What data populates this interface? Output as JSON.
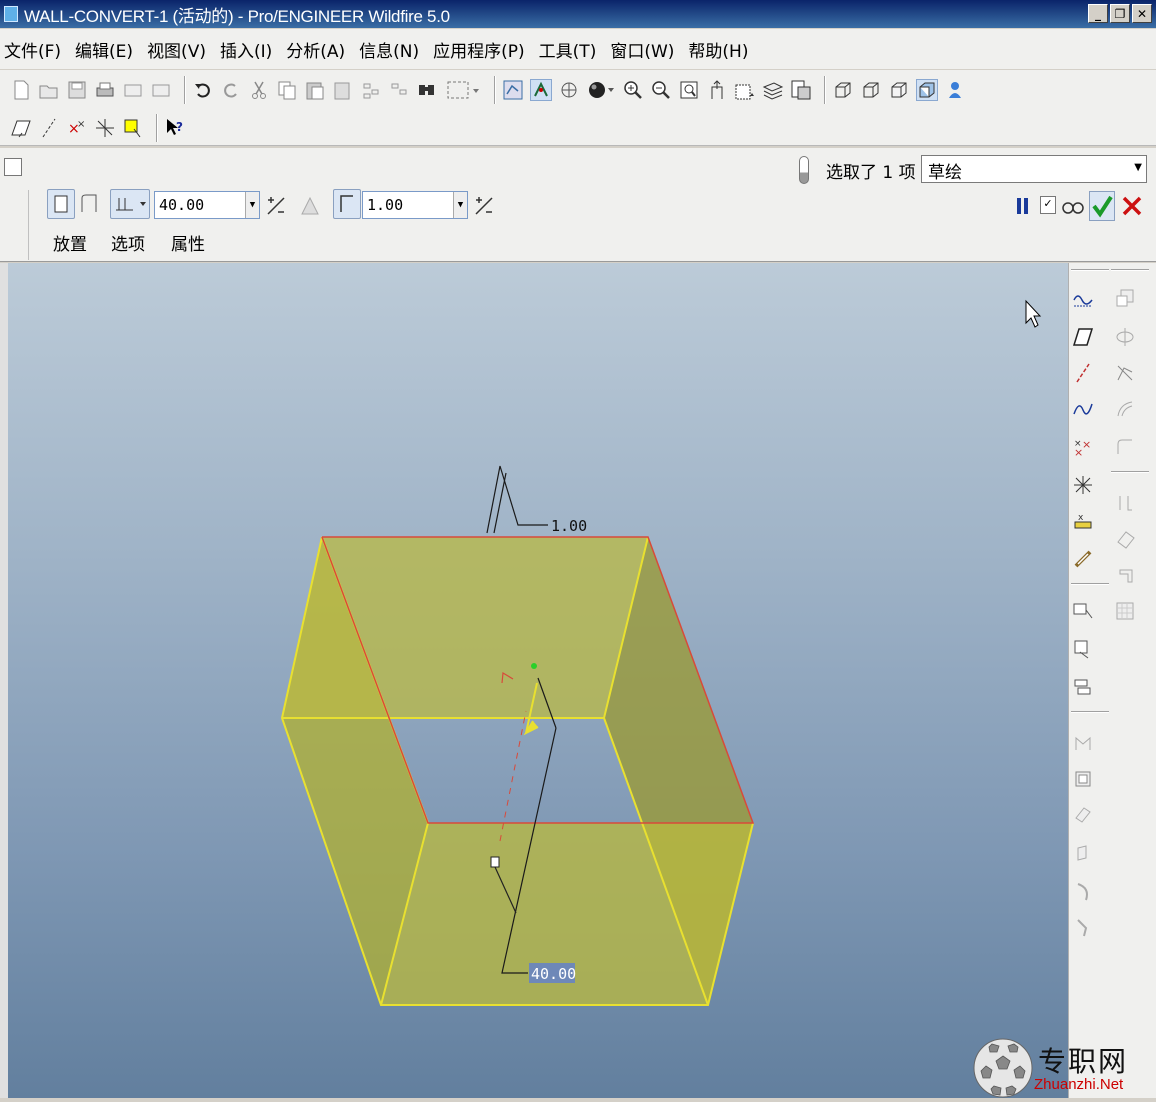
{
  "window": {
    "title": "WALL-CONVERT-1 (活动的) - Pro/ENGINEER Wildfire 5.0"
  },
  "menu": [
    "文件(F)",
    "编辑(E)",
    "视图(V)",
    "插入(I)",
    "分析(A)",
    "信息(N)",
    "应用程序(P)",
    "工具(T)",
    "窗口(W)",
    "帮助(H)"
  ],
  "selection": {
    "status": "选取了 1 项",
    "filter": "草绘"
  },
  "dashboard": {
    "height_value": "40.00",
    "thickness_value": "1.00",
    "tabs": [
      "放置",
      "选项",
      "属性"
    ]
  },
  "viewport": {
    "dim_thickness": "1.00",
    "dim_height": "40.00"
  },
  "watermark": {
    "cn": "专职网",
    "en": "Zhuanzhi.Net"
  },
  "colors": {
    "title_bar": "#0a246a",
    "part_fill": "#b5b83a",
    "edge_highlight": "#e8e030",
    "edge_red": "#d84a3a",
    "accept_check": "#1a9a2a",
    "cancel_x": "#cc1111"
  },
  "icons": [
    "new-file-icon",
    "open-icon",
    "save-icon",
    "print-icon",
    "undo-icon",
    "redo-icon",
    "cut-icon",
    "copy-icon",
    "paste-icon",
    "regenerate-icon",
    "zoom-in-icon",
    "zoom-out-icon",
    "refit-icon",
    "pause-icon",
    "preview-icon",
    "accept-icon",
    "cancel-icon"
  ]
}
